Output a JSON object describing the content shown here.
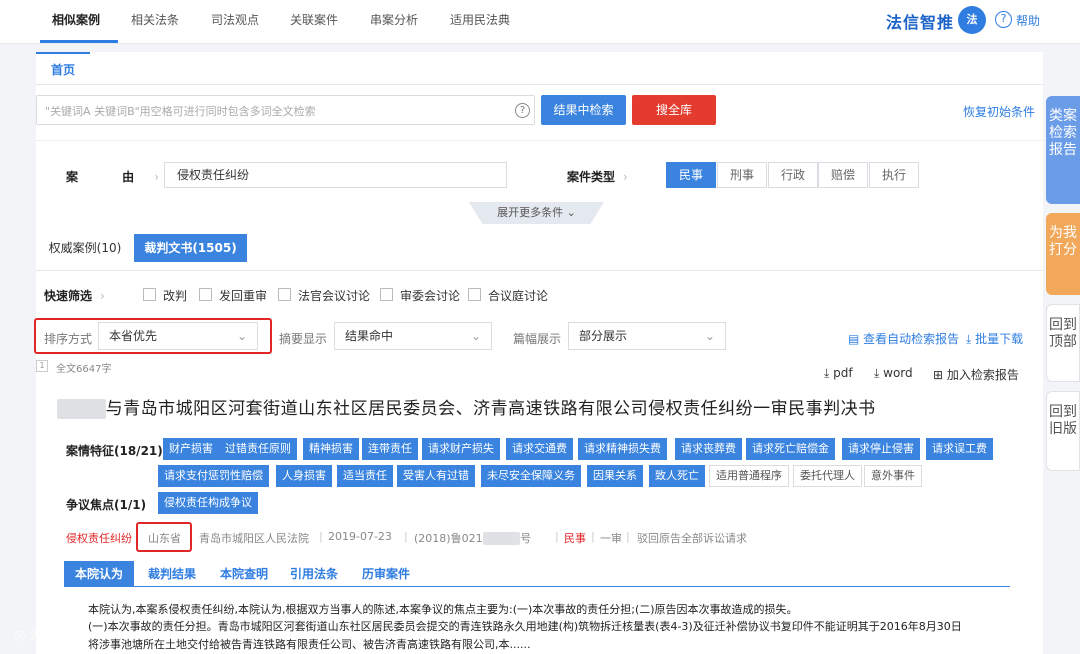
{
  "topnav": {
    "tabs": [
      "相似案例",
      "相关法条",
      "司法观点",
      "关联案件",
      "串案分析",
      "适用民法典"
    ],
    "brand": "法信智推",
    "brand_icon": "法",
    "help": "帮助"
  },
  "home_tab": "首页",
  "search": {
    "placeholder": "\"关键词A 关键词B\"用空格可进行同时包含多词全文检索",
    "search_in_results": "结果中检索",
    "search_all": "搜全库",
    "restore": "恢复初始条件"
  },
  "conditions": {
    "cause_label": "案 由",
    "cause_value": "侵权责任纠纷",
    "type_label": "案件类型",
    "types": [
      "民事",
      "刑事",
      "行政",
      "赔偿",
      "执行"
    ],
    "expand": "展开更多条件"
  },
  "subtabs": [
    "权威案例(10)",
    "裁判文书(1505)"
  ],
  "quick_filter": {
    "label": "快速筛选",
    "options": [
      "改判",
      "发回重审",
      "法官会议讨论",
      "审委会讨论",
      "合议庭讨论"
    ]
  },
  "sort": {
    "sort_label": "排序方式",
    "sort_value": "本省优先",
    "summary_label": "摘要显示",
    "summary_value": "结果命中",
    "length_label": "篇幅展示",
    "length_value": "部分展示",
    "auto_report": "查看自动检索报告",
    "batch_download": "批量下载"
  },
  "result": {
    "fulltext": "全文6647字",
    "index": "1",
    "actions": [
      "pdf",
      "word",
      "加入检索报告"
    ],
    "title": "与青岛市城阳区河套街道山东社区居民委员会、济青高速铁路有限公司侵权责任纠纷一审民事判决书",
    "features_label": "案情特征(18/21)",
    "features_row1": [
      "财产损害",
      "过错责任原则",
      "精神损害",
      "连带责任",
      "请求财产损失",
      "请求交通费",
      "请求精神损失费",
      "请求丧葬费",
      "请求死亡赔偿金",
      "请求停止侵害",
      "请求误工费"
    ],
    "features_row2": [
      "请求支付惩罚性赔偿",
      "人身损害",
      "适当责任",
      "受害人有过错",
      "未尽安全保障义务",
      "因果关系",
      "致人死亡"
    ],
    "features_row2_white": [
      "适用普通程序",
      "委托代理人",
      "意外事件"
    ],
    "focus_label": "争议焦点(1/1)",
    "focus_tag": "侵权责任构成争议",
    "meta": {
      "cause": "侵权责任纠纷",
      "province": "山东省",
      "court": "青岛市城阳区人民法院",
      "date": "2019-07-23",
      "case_no_prefix": "(2018)鲁021",
      "case_no_suffix": "号",
      "type": "民事",
      "level": "一审",
      "outcome": "驳回原告全部诉讼请求"
    },
    "tabs": [
      "本院认为",
      "裁判结果",
      "本院查明",
      "引用法条",
      "历审案件"
    ],
    "text_lines": [
      "本院认为,本案系侵权责任纠纷,本院认为,根据双方当事人的陈述,本案争议的焦点主要为:(一)本次事故的责任分担;(二)原告因本次事故造成的损失。",
      "(一)本次事故的责任分担。青岛市城阳区河套街道山东社区居民委员会提交的青连铁路永久用地建(构)筑物拆迁核量表(表4-3)及征迁补偿协议书复印件不能证明其于2016年8月30日",
      "将涉事池塘所在土地交付给被告青连铁路有限责任公司、被告济青高速铁路有限公司,本......"
    ]
  },
  "sidebar": [
    "类案检索报告",
    "为我打分",
    "回到顶部",
    "回到旧版"
  ],
  "watermark": "大鹏"
}
